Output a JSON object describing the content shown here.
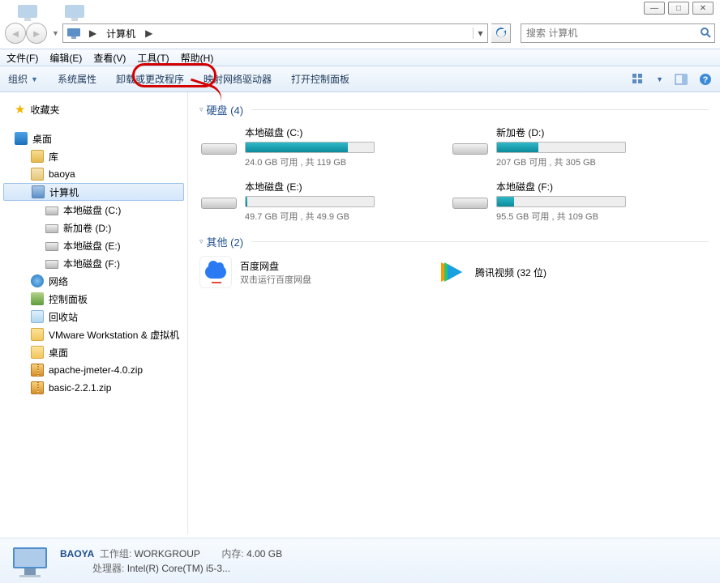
{
  "window_controls": {
    "min": "—",
    "max": "□",
    "close": "✕"
  },
  "nav": {
    "crumb_root": "计算机",
    "crumb_arrow": "▶",
    "search_placeholder": "搜索 计算机"
  },
  "menubar": [
    "文件(F)",
    "编辑(E)",
    "查看(V)",
    "工具(T)",
    "帮助(H)"
  ],
  "toolbar": {
    "organize": "组织",
    "items": [
      "系统属性",
      "卸载或更改程序",
      "映射网络驱动器",
      "打开控制面板"
    ]
  },
  "sidebar": {
    "favorites": "收藏夹",
    "desktop": "桌面",
    "library": "库",
    "user": "baoya",
    "computer": "计算机",
    "drives": [
      "本地磁盘 (C:)",
      "新加卷 (D:)",
      "本地磁盘 (E:)",
      "本地磁盘 (F:)"
    ],
    "network": "网络",
    "controlpanel": "控制面板",
    "recyclebin": "回收站",
    "vmware": "VMware Workstation &  虚拟机",
    "desktop2": "桌面",
    "jmeter": "apache-jmeter-4.0.zip",
    "basic": "basic-2.2.1.zip"
  },
  "groups": {
    "hdd_label": "硬盘 (4)",
    "other_label": "其他 (2)"
  },
  "drives": [
    {
      "name": "本地磁盘 (C:)",
      "stat": "24.0 GB 可用 , 共 119 GB",
      "pct": 80
    },
    {
      "name": "新加卷 (D:)",
      "stat": "207 GB 可用 , 共 305 GB",
      "pct": 32
    },
    {
      "name": "本地磁盘 (E:)",
      "stat": "49.7 GB 可用 , 共 49.9 GB",
      "pct": 1
    },
    {
      "name": "本地磁盘 (F:)",
      "stat": "95.5 GB 可用 , 共 109 GB",
      "pct": 13
    }
  ],
  "others": [
    {
      "name": "百度网盘",
      "sub": "双击运行百度网盘"
    },
    {
      "name": "腾讯视频 (32 位)",
      "sub": ""
    }
  ],
  "status": {
    "name": "BAOYA",
    "wg_label": "工作组:",
    "wg_value": "WORKGROUP",
    "mem_label": "内存:",
    "mem_value": "4.00 GB",
    "cpu_label": "处理器:",
    "cpu_value": "Intel(R) Core(TM) i5-3..."
  }
}
